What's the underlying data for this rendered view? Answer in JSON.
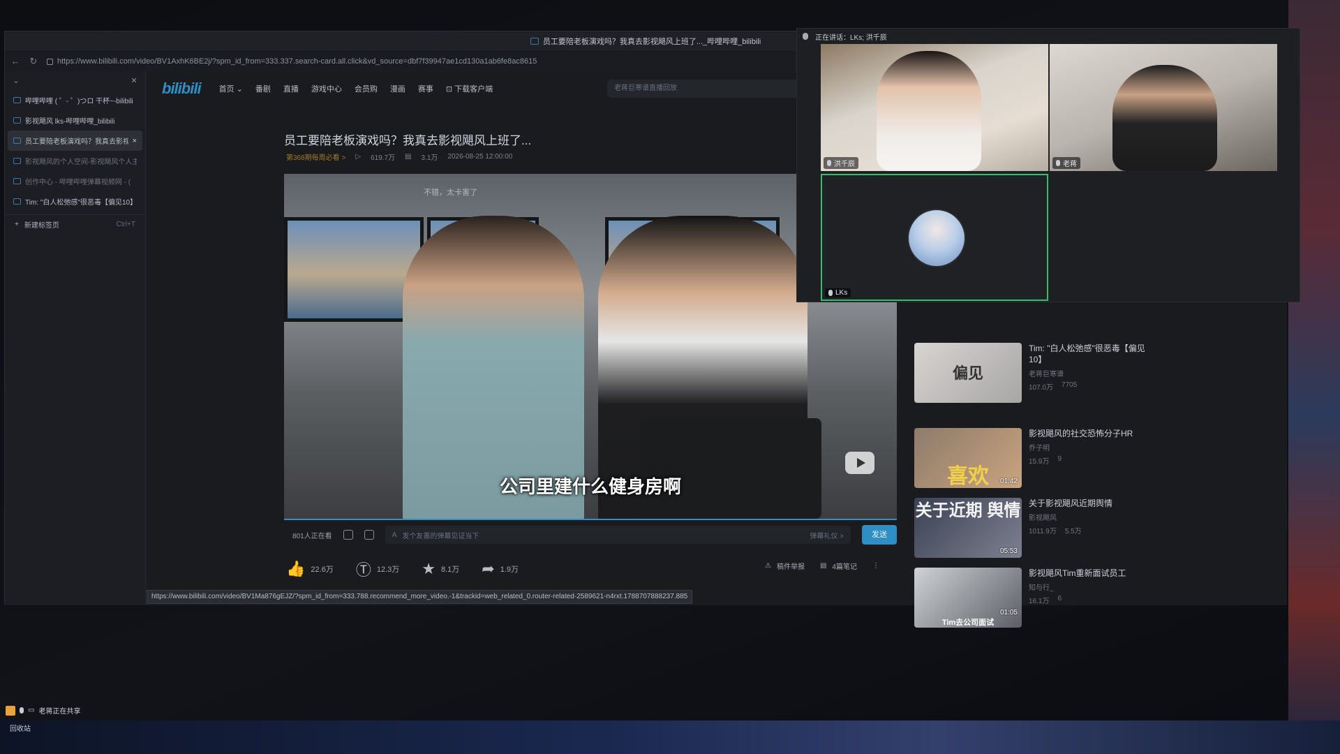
{
  "browser": {
    "window_title": "员工要陪老板演戏吗？我真去影视飓风上班了..._哔哩哔哩_bilibili",
    "url": "https://www.bilibili.com/video/BV1AxhK6BE2j/?spm_id_from=333.337.search-card.all.click&vd_source=dbf7f39947ae1cd130a1ab6fe8ac8615",
    "status_url": "https://www.bilibili.com/video/BV1Ma876gEJZ/?spm_id_from=333.788.recommend_more_video.-1&trackid=web_related_0.router-related-2589621-n4rxt.1788707888237.885"
  },
  "tabs": [
    {
      "label": "哔哩哔哩 ( ゜- ゜)つロ 干杯~-bilibili"
    },
    {
      "label": "影视飓风 lks-哔哩哔哩_bilibili"
    },
    {
      "label": "员工要陪老板演戏吗？我真去影视",
      "close": "×"
    },
    {
      "label": "影视飓风的个人空间-影视飓风个人主"
    },
    {
      "label": "创作中心 - 哔哩哔哩弹幕视频网 - ("
    },
    {
      "label": "Tim: \"白人松弛感\"很恶毒【偏见10】"
    }
  ],
  "new_tab": {
    "label": "新建标签页",
    "shortcut": "Ctrl+T"
  },
  "nav": {
    "logo": "bilibili",
    "items": [
      "首页",
      "番剧",
      "直播",
      "游戏中心",
      "会员购",
      "漫画",
      "赛事",
      "下载客户端"
    ],
    "search_placeholder": "老蒋巨寒谱直播回放"
  },
  "video": {
    "title": "员工要陪老板演戏吗？我真去影视飓风上班了...",
    "tag": "第368期每周必看 >",
    "views": "619.7万",
    "danmaku": "3.1万",
    "date": "2026-08-25 12:00:00",
    "subtitle": "公司里建什么健身房啊",
    "top_danmu": "不错，太卡害了"
  },
  "danmu_bar": {
    "watching": "801人正在看",
    "placeholder": "发个友善的弹幕见证当下",
    "etiquette": "弹幕礼仪 >",
    "send": "发送"
  },
  "actions": {
    "like": "22.6万",
    "coin": "12.3万",
    "fav": "8.1万",
    "share": "1.9万",
    "report": "稿件举报",
    "notes": "4篇笔记"
  },
  "recommendations": [
    {
      "title": "Tim: \"白人松弛感\"很恶毒【偏见10】",
      "up": "老蒋巨寒谱",
      "views": "107.0万",
      "danmaku": "7705",
      "thumb_text": "偏见"
    },
    {
      "title": "影视飓风的社交恐怖分子HR",
      "up": "乔子明",
      "views": "15.9万",
      "danmaku": "9",
      "duration": "01:42",
      "thumb_text": "喜欢"
    },
    {
      "title": "关于影视飓风近期舆情",
      "up": "影视飓风",
      "views": "1011.9万",
      "danmaku": "5.5万",
      "duration": "05:53",
      "thumb_text": "关于近期 舆情"
    },
    {
      "title": "影视飓风Tim重新面试员工",
      "up": "知与行_",
      "views": "16.1万",
      "danmaku": "6",
      "duration": "01:05",
      "thumb_text": "Tim去公司面试"
    }
  ],
  "call": {
    "speaking": "正在讲话：LKs; 洪千辰",
    "participants": [
      "洪千辰",
      "老蒋",
      "LKs"
    ]
  },
  "share_indicator": "老蒋正在共享",
  "desktop": {
    "recycle_bin": "回收站"
  }
}
